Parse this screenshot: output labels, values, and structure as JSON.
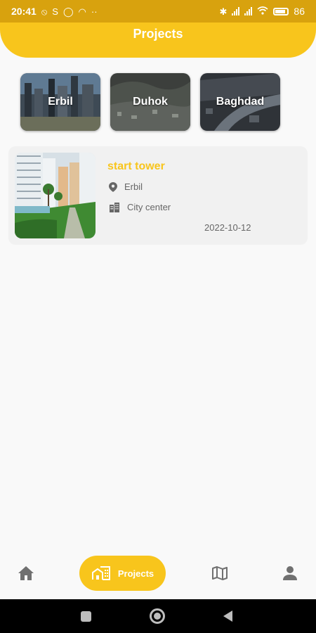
{
  "status_bar": {
    "time": "20:41",
    "battery_text": "86",
    "battery_level": 0.86,
    "icons": [
      "alarm-off-icon",
      "s-icon",
      "circle-icon",
      "arc-icon",
      "dots-icon",
      "bluetooth-icon",
      "signal-icon",
      "signal-icon",
      "wifi-icon",
      "battery-icon"
    ]
  },
  "header": {
    "title": "Projects",
    "color": "#f8c51c"
  },
  "cities": [
    {
      "label": "Erbil"
    },
    {
      "label": "Duhok"
    },
    {
      "label": "Baghdad"
    }
  ],
  "project": {
    "name": "start tower",
    "location": "Erbil",
    "area": "City center",
    "date": "2022-10-12"
  },
  "bottom_nav": {
    "items": [
      {
        "icon": "home-icon"
      },
      {
        "icon": "projects-icon",
        "label": "Projects",
        "active": true
      },
      {
        "icon": "map-icon"
      },
      {
        "icon": "person-icon"
      }
    ]
  }
}
